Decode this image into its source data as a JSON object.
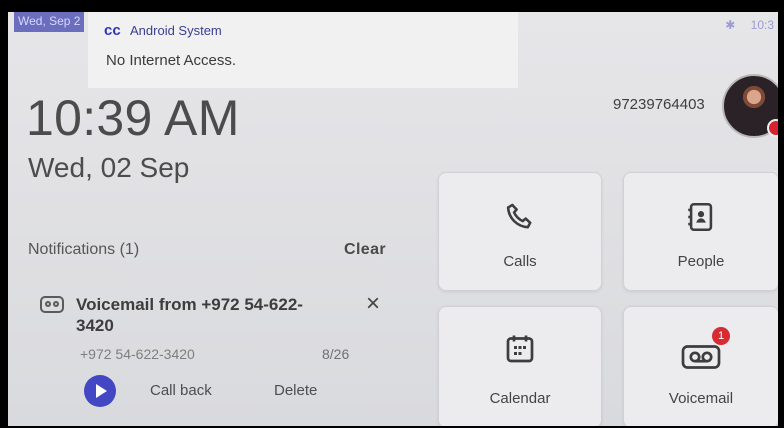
{
  "statusbar": {
    "date": "Wed, Sep 2",
    "time": "10:3"
  },
  "toast": {
    "app": "Android System",
    "message": "No Internet Access."
  },
  "home": {
    "time": "10:39 AM",
    "date": "Wed, 02 Sep",
    "number": "97239764403"
  },
  "notifications": {
    "label": "Notifications (1)",
    "clear_label": "Clear",
    "item": {
      "title": "Voicemail from +972 54-622-3420",
      "subtitle": "+972 54-622-3420",
      "time": "8/26",
      "callback_label": "Call back",
      "delete_label": "Delete"
    }
  },
  "tiles": {
    "calls": "Calls",
    "people": "People",
    "calendar": "Calendar",
    "voicemail": "Voicemail",
    "voicemail_badge": "1"
  },
  "icons": {
    "status_bluetooth": "bluetooth-icon",
    "voicemail": "voicemail-icon",
    "calls": "phone-icon",
    "people": "contacts-icon",
    "calendar": "calendar-icon",
    "close": "close-icon",
    "play": "play-icon"
  },
  "colors": {
    "accent": "#4347c3",
    "badge": "#d72b34"
  }
}
